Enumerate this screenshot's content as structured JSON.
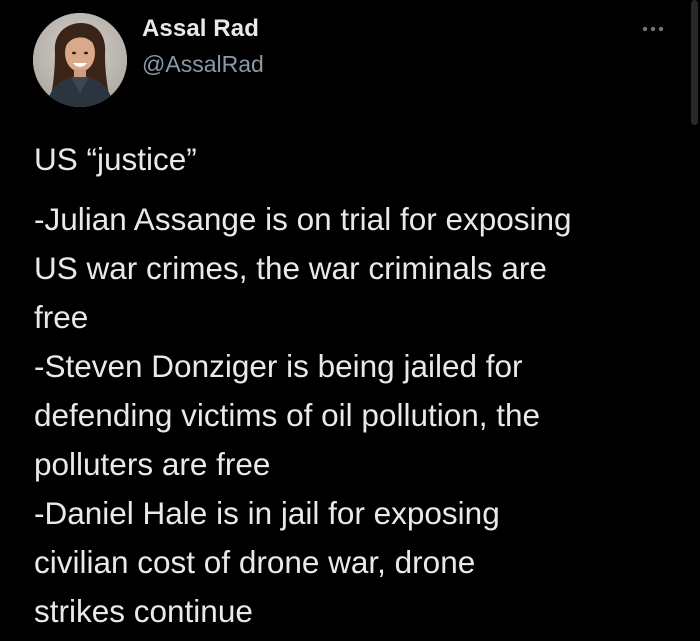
{
  "author": {
    "display_name": "Assal Rad",
    "handle": "@AssalRad",
    "avatar_icon": "profile-photo"
  },
  "more_icon": "more-options-icon",
  "tweet": {
    "heading": "US “justice”",
    "lines": [
      "-Julian Assange is on trial for exposing",
      "US war crimes, the war criminals are",
      "free",
      "-Steven Donziger is being jailed for",
      "defending victims of oil pollution, the",
      "polluters are free",
      "-Daniel Hale is in jail for exposing",
      "civilian cost of drone war, drone",
      "strikes continue"
    ]
  },
  "colors": {
    "background": "#000000",
    "text_primary": "#e7e9ea",
    "text_secondary": "#8b98a5"
  }
}
